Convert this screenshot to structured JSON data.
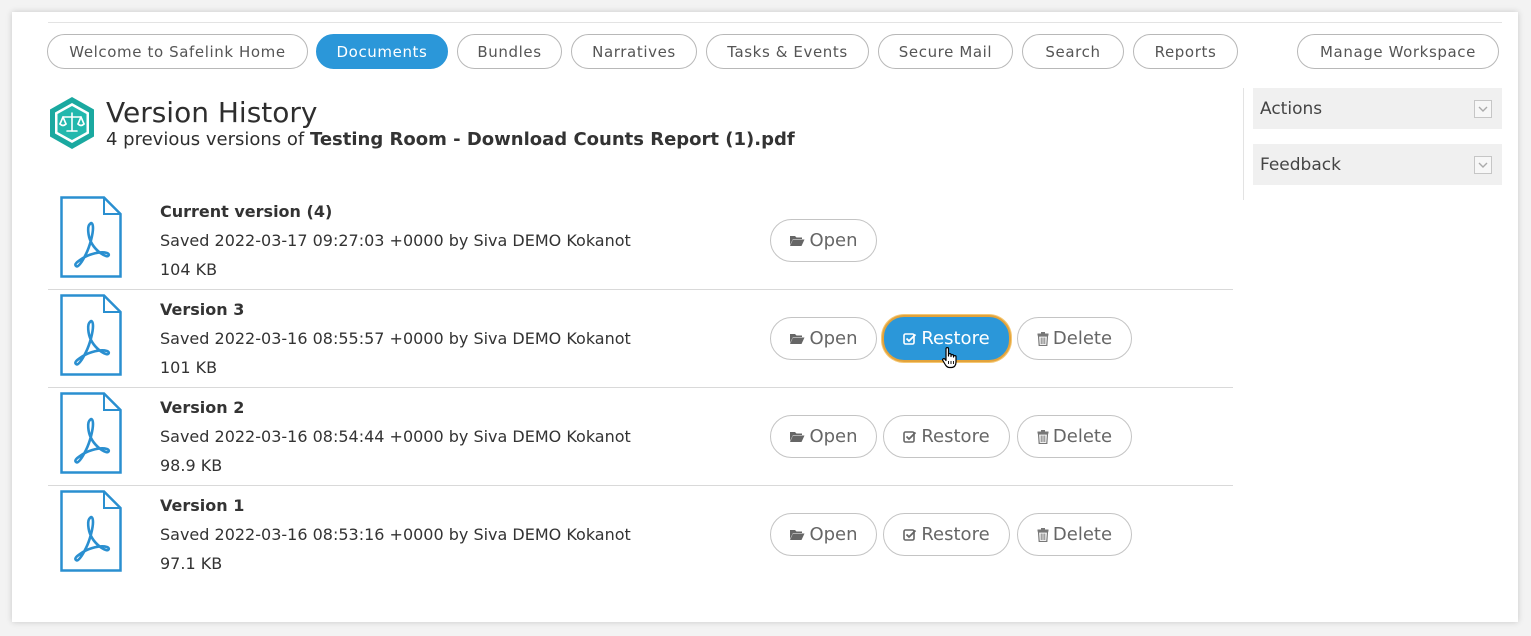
{
  "nav": {
    "items": [
      {
        "label": "Welcome to Safelink Home"
      },
      {
        "label": "Documents",
        "active": true
      },
      {
        "label": "Bundles"
      },
      {
        "label": "Narratives"
      },
      {
        "label": "Tasks & Events"
      },
      {
        "label": "Secure Mail"
      },
      {
        "label": "Search"
      },
      {
        "label": "Reports"
      }
    ],
    "manage": "Manage Workspace"
  },
  "header": {
    "title": "Version History",
    "subtitle_prefix": "4 previous versions of ",
    "filename": "Testing Room - Download Counts Report (1).pdf",
    "logo_icon": "balance-scale-hexagon-icon"
  },
  "versions": [
    {
      "title": "Current version (4)",
      "saved": "Saved 2022-03-17 09:27:03 +0000 by Siva DEMO Kokanot",
      "size": "104 KB"
    },
    {
      "title": "Version 3",
      "saved": "Saved 2022-03-16 08:55:57 +0000 by Siva DEMO Kokanot",
      "size": "101 KB",
      "focused_action": "Restore"
    },
    {
      "title": "Version 2",
      "saved": "Saved 2022-03-16 08:54:44 +0000 by Siva DEMO Kokanot",
      "size": "98.9 KB"
    },
    {
      "title": "Version 1",
      "saved": "Saved 2022-03-16 08:53:16 +0000 by Siva DEMO Kokanot",
      "size": "97.1 KB"
    }
  ],
  "buttons": {
    "open": "Open",
    "restore": "Restore",
    "delete": "Delete"
  },
  "sidebar": {
    "actions": "Actions",
    "feedback": "Feedback"
  },
  "colors": {
    "accent": "#2b97d9",
    "focus_ring": "#e3a33b",
    "logo_teal": "#1aa9a0",
    "pdf_blue": "#2a8fd0"
  }
}
